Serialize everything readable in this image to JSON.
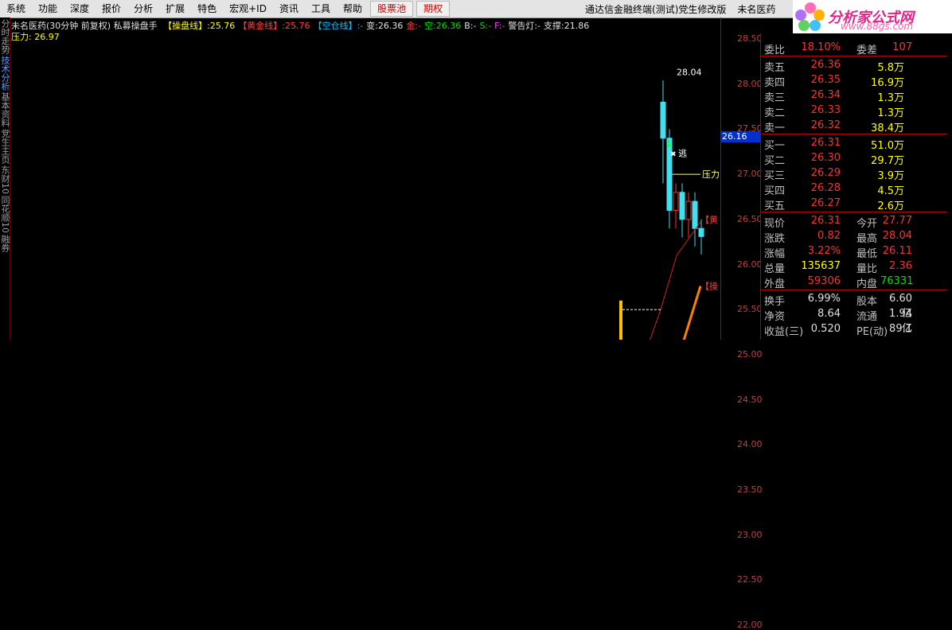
{
  "menu": {
    "items": [
      "系统",
      "功能",
      "深度",
      "报价",
      "分析",
      "扩展",
      "特色",
      "宏观+ID",
      "资讯",
      "工具",
      "帮助"
    ],
    "special": [
      "股票池",
      "期权"
    ],
    "window_title": "通达信金融终端(测试)党生修改版",
    "stock_name": "未名医药"
  },
  "logo": {
    "name": "分析家公式网",
    "url": "www.88gs.com"
  },
  "left_tabs": [
    "分时走势",
    "技术分析",
    "基本资料",
    "党生主页",
    "东财10",
    "同花顺10",
    "融券"
  ],
  "header": {
    "title": "未名医药(30分钟 前复权) 私募操盘手",
    "items": [
      {
        "label": "【操盘线】:",
        "value": "25.76",
        "color": "#ffff00"
      },
      {
        "label": "【黄金线】:",
        "value": "25.76",
        "color": "#ff4040"
      },
      {
        "label": "【空仓线】:",
        "value": "-",
        "color": "#00c0ff"
      },
      {
        "label": "变:",
        "value": "26.36",
        "color": "#e0e0e0"
      },
      {
        "label": "金:",
        "value": "-",
        "color": "#ff4040"
      },
      {
        "label": "空:",
        "value": "26.36",
        "color": "#00e000"
      },
      {
        "label": "B:",
        "value": "-",
        "color": "#e0e0e0"
      },
      {
        "label": "S:",
        "value": "-",
        "color": "#00e000"
      },
      {
        "label": "F:",
        "value": "-",
        "color": "#ff40ff"
      },
      {
        "label": "警告灯:",
        "value": "-",
        "color": "#e0e0e0"
      },
      {
        "label": "支撑:",
        "value": "21.86",
        "color": "#e0e0e0"
      }
    ],
    "pressure": "压力: 26.97"
  },
  "annotations": {
    "escape": "逃",
    "pressure": "压力",
    "support": "支撑",
    "high": "28.04",
    "cur": "26.16",
    "cao": "【操",
    "huang": "【黄"
  },
  "chart_data": {
    "type": "candlestick",
    "ylim": [
      21.9,
      28.6
    ],
    "y_ticks": [
      "28.50",
      "28.00",
      "27.50",
      "27.00",
      "26.50",
      "26.00",
      "25.50",
      "25.00",
      "24.50",
      "24.00",
      "23.50",
      "23.00",
      "22.50",
      "22.00"
    ]
  },
  "quote": {
    "weibi": {
      "label": "委比",
      "value": "18.10%",
      "label2": "委差",
      "value2": "107"
    },
    "sell": [
      {
        "label": "卖五",
        "price": "26.36",
        "vol": "5.8万"
      },
      {
        "label": "卖四",
        "price": "26.35",
        "vol": "16.9万"
      },
      {
        "label": "卖三",
        "price": "26.34",
        "vol": "1.3万"
      },
      {
        "label": "卖二",
        "price": "26.33",
        "vol": "1.3万"
      },
      {
        "label": "卖一",
        "price": "26.32",
        "vol": "38.4万"
      }
    ],
    "buy": [
      {
        "label": "买一",
        "price": "26.31",
        "vol": "51.0万"
      },
      {
        "label": "买二",
        "price": "26.30",
        "vol": "29.7万"
      },
      {
        "label": "买三",
        "price": "26.29",
        "vol": "3.9万"
      },
      {
        "label": "买四",
        "price": "26.28",
        "vol": "4.5万"
      },
      {
        "label": "买五",
        "price": "26.27",
        "vol": "2.6万"
      }
    ],
    "stats": [
      {
        "l1": "现价",
        "v1": "26.31",
        "l2": "今开",
        "v2": "27.77",
        "c1": "#ff3030",
        "c2": "#ff3030"
      },
      {
        "l1": "涨跌",
        "v1": "0.82",
        "l2": "最高",
        "v2": "28.04",
        "c1": "#ff3030",
        "c2": "#ff3030"
      },
      {
        "l1": "涨幅",
        "v1": "3.22%",
        "l2": "最低",
        "v2": "26.11",
        "c1": "#ff3030",
        "c2": "#ff3030"
      },
      {
        "l1": "总量",
        "v1": "135637",
        "l2": "量比",
        "v2": "2.36",
        "c1": "#ffff00",
        "c2": "#ff3030"
      },
      {
        "l1": "外盘",
        "v1": "59306",
        "l2": "内盘",
        "v2": "76331",
        "c1": "#ff3030",
        "c2": "#00e000"
      }
    ],
    "fin": [
      {
        "l1": "换手",
        "v1": "6.99%",
        "l2": "股本",
        "v2": "6.60亿"
      },
      {
        "l1": "净资",
        "v1": "8.64",
        "l2": "流通",
        "v2": "1.94亿"
      },
      {
        "l1": "收益(三)",
        "v1": "0.520",
        "l2": "PE(动)",
        "v2": "89.1"
      }
    ]
  }
}
